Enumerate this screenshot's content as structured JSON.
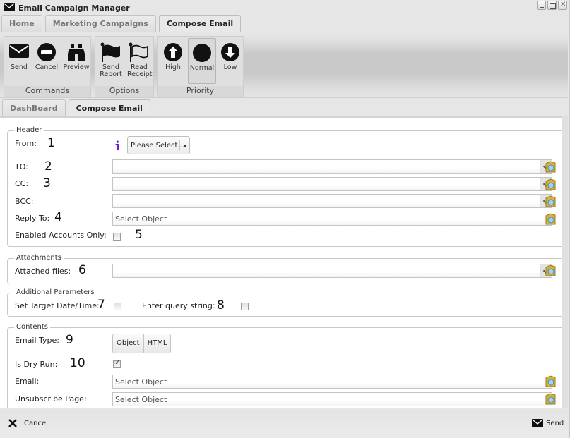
{
  "window": {
    "title": "Email Campaign Manager",
    "icon": "envelope-icon",
    "controls": [
      "minimize",
      "maximize",
      "close"
    ]
  },
  "main_tabs": [
    {
      "label": "Home",
      "active": false
    },
    {
      "label": "Marketing Campaigns",
      "active": false
    },
    {
      "label": "Compose Email",
      "active": true
    }
  ],
  "ribbon": {
    "groups": [
      {
        "label": "Commands",
        "buttons": [
          {
            "label": "Send",
            "icon": "envelope-icon"
          },
          {
            "label": "Cancel",
            "icon": "no-entry-icon"
          },
          {
            "label": "Preview",
            "icon": "binoculars-icon"
          }
        ]
      },
      {
        "label": "Options",
        "buttons": [
          {
            "label": "Send Report",
            "icon": "flag-filled-icon"
          },
          {
            "label": "Read Receipt",
            "icon": "flag-outline-icon"
          }
        ]
      },
      {
        "label": "Priority",
        "buttons": [
          {
            "label": "High",
            "icon": "arrow-up-circle-icon"
          },
          {
            "label": "Normal",
            "icon": "circle-icon",
            "selected": true
          },
          {
            "label": "Low",
            "icon": "arrow-down-circle-icon"
          }
        ]
      }
    ]
  },
  "sub_tabs": [
    {
      "label": "DashBoard",
      "active": false
    },
    {
      "label": "Compose Email",
      "active": true
    }
  ],
  "sections": {
    "header": {
      "legend": "Header",
      "from_label": "From:",
      "from_select": "Please Select...",
      "to_label": "TO:",
      "to_value": "",
      "cc_label": "CC:",
      "cc_value": "",
      "bcc_label": "BCC:",
      "bcc_value": "",
      "reply_to_label": "Reply To:",
      "reply_to_placeholder": "Select Object",
      "enabled_accounts_label": "Enabled Accounts Only:",
      "enabled_accounts_checked": false
    },
    "attachments": {
      "legend": "Attachments",
      "attached_files_label": "Attached files:",
      "attached_files_value": ""
    },
    "additional": {
      "legend": "Additional Parameters",
      "target_date_label": "Set Target Date/Time:",
      "target_date_checked": false,
      "query_string_label": "Enter query string:",
      "query_string_checked": false
    },
    "contents": {
      "legend": "Contents",
      "email_type_label": "Email Type:",
      "email_type_options": [
        "Object",
        "HTML"
      ],
      "dry_run_label": "Is Dry Run:",
      "dry_run_checked": true,
      "email_label": "Email:",
      "email_placeholder": "Select Object",
      "unsubscribe_label": "Unsubscribe Page:",
      "unsubscribe_placeholder": "Select Object"
    }
  },
  "annotations": [
    "1",
    "2",
    "3",
    "4",
    "5",
    "6",
    "7",
    "8",
    "9",
    "10"
  ],
  "footer": {
    "cancel_label": "Cancel",
    "send_label": "Send"
  },
  "colors": {
    "info_icon": "#6b1bd6",
    "background": "#e6e6e6"
  }
}
